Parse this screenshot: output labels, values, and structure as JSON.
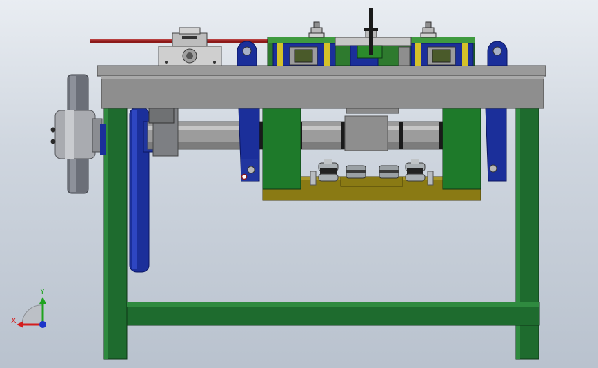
{
  "viewport": {
    "width": 867,
    "height": 533
  },
  "colors": {
    "frame_green": "#1e6b2e",
    "frame_green_light": "#2f8a3f",
    "tabletop_gray": "#8e8e8e",
    "tabletop_top": "#9a9a9a",
    "shaft_gray": "#9c9c9c",
    "bracket_blue": "#1b2f9a",
    "olive_plate": "#8a7a14",
    "belt_red": "#8c1a1a",
    "pulley_gray": "#7d8088",
    "axis_x_red": "#d41d1d",
    "axis_y_green": "#1fa31f",
    "axis_z_blue": "#1d35c9"
  },
  "model": {
    "name": "",
    "parts": [
      "welded-frame",
      "tabletop-plate",
      "main-shaft",
      "drive-pulley",
      "chain-sprocket",
      "support-bracket-left",
      "support-bracket-right",
      "clamp-block-left",
      "clamp-block-right",
      "roller-assembly",
      "tensioner-rod",
      "belt"
    ]
  },
  "triad": {
    "x_label": "X",
    "y_label": "Y",
    "icons": [
      "x-axis-arrow-icon",
      "y-axis-arrow-icon",
      "z-axis-dot-icon",
      "view-plane-icon"
    ]
  }
}
